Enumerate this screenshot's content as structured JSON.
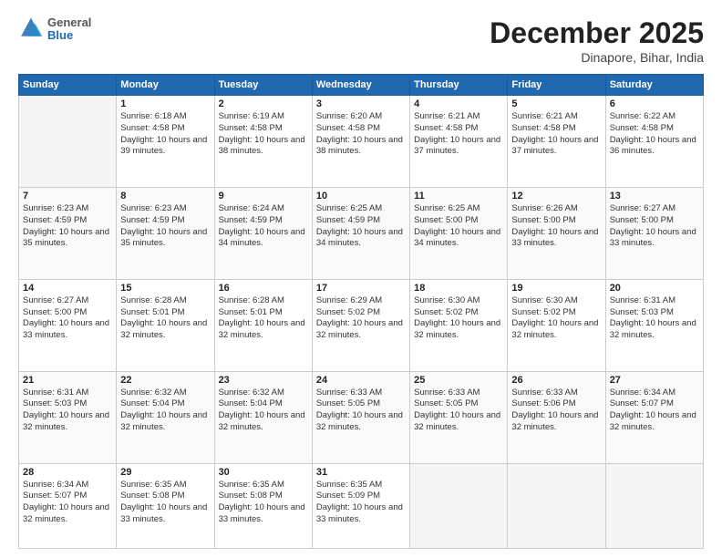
{
  "header": {
    "logo_general": "General",
    "logo_blue": "Blue",
    "month_year": "December 2025",
    "location": "Dinapore, Bihar, India"
  },
  "weekdays": [
    "Sunday",
    "Monday",
    "Tuesday",
    "Wednesday",
    "Thursday",
    "Friday",
    "Saturday"
  ],
  "weeks": [
    [
      {
        "day": "",
        "empty": true
      },
      {
        "day": "1",
        "sunrise": "6:18 AM",
        "sunset": "4:58 PM",
        "daylight": "10 hours and 39 minutes."
      },
      {
        "day": "2",
        "sunrise": "6:19 AM",
        "sunset": "4:58 PM",
        "daylight": "10 hours and 38 minutes."
      },
      {
        "day": "3",
        "sunrise": "6:20 AM",
        "sunset": "4:58 PM",
        "daylight": "10 hours and 38 minutes."
      },
      {
        "day": "4",
        "sunrise": "6:21 AM",
        "sunset": "4:58 PM",
        "daylight": "10 hours and 37 minutes."
      },
      {
        "day": "5",
        "sunrise": "6:21 AM",
        "sunset": "4:58 PM",
        "daylight": "10 hours and 37 minutes."
      },
      {
        "day": "6",
        "sunrise": "6:22 AM",
        "sunset": "4:58 PM",
        "daylight": "10 hours and 36 minutes."
      }
    ],
    [
      {
        "day": "7",
        "sunrise": "6:23 AM",
        "sunset": "4:59 PM",
        "daylight": "10 hours and 35 minutes."
      },
      {
        "day": "8",
        "sunrise": "6:23 AM",
        "sunset": "4:59 PM",
        "daylight": "10 hours and 35 minutes."
      },
      {
        "day": "9",
        "sunrise": "6:24 AM",
        "sunset": "4:59 PM",
        "daylight": "10 hours and 34 minutes."
      },
      {
        "day": "10",
        "sunrise": "6:25 AM",
        "sunset": "4:59 PM",
        "daylight": "10 hours and 34 minutes."
      },
      {
        "day": "11",
        "sunrise": "6:25 AM",
        "sunset": "5:00 PM",
        "daylight": "10 hours and 34 minutes."
      },
      {
        "day": "12",
        "sunrise": "6:26 AM",
        "sunset": "5:00 PM",
        "daylight": "10 hours and 33 minutes."
      },
      {
        "day": "13",
        "sunrise": "6:27 AM",
        "sunset": "5:00 PM",
        "daylight": "10 hours and 33 minutes."
      }
    ],
    [
      {
        "day": "14",
        "sunrise": "6:27 AM",
        "sunset": "5:00 PM",
        "daylight": "10 hours and 33 minutes."
      },
      {
        "day": "15",
        "sunrise": "6:28 AM",
        "sunset": "5:01 PM",
        "daylight": "10 hours and 32 minutes."
      },
      {
        "day": "16",
        "sunrise": "6:28 AM",
        "sunset": "5:01 PM",
        "daylight": "10 hours and 32 minutes."
      },
      {
        "day": "17",
        "sunrise": "6:29 AM",
        "sunset": "5:02 PM",
        "daylight": "10 hours and 32 minutes."
      },
      {
        "day": "18",
        "sunrise": "6:30 AM",
        "sunset": "5:02 PM",
        "daylight": "10 hours and 32 minutes."
      },
      {
        "day": "19",
        "sunrise": "6:30 AM",
        "sunset": "5:02 PM",
        "daylight": "10 hours and 32 minutes."
      },
      {
        "day": "20",
        "sunrise": "6:31 AM",
        "sunset": "5:03 PM",
        "daylight": "10 hours and 32 minutes."
      }
    ],
    [
      {
        "day": "21",
        "sunrise": "6:31 AM",
        "sunset": "5:03 PM",
        "daylight": "10 hours and 32 minutes."
      },
      {
        "day": "22",
        "sunrise": "6:32 AM",
        "sunset": "5:04 PM",
        "daylight": "10 hours and 32 minutes."
      },
      {
        "day": "23",
        "sunrise": "6:32 AM",
        "sunset": "5:04 PM",
        "daylight": "10 hours and 32 minutes."
      },
      {
        "day": "24",
        "sunrise": "6:33 AM",
        "sunset": "5:05 PM",
        "daylight": "10 hours and 32 minutes."
      },
      {
        "day": "25",
        "sunrise": "6:33 AM",
        "sunset": "5:05 PM",
        "daylight": "10 hours and 32 minutes."
      },
      {
        "day": "26",
        "sunrise": "6:33 AM",
        "sunset": "5:06 PM",
        "daylight": "10 hours and 32 minutes."
      },
      {
        "day": "27",
        "sunrise": "6:34 AM",
        "sunset": "5:07 PM",
        "daylight": "10 hours and 32 minutes."
      }
    ],
    [
      {
        "day": "28",
        "sunrise": "6:34 AM",
        "sunset": "5:07 PM",
        "daylight": "10 hours and 32 minutes."
      },
      {
        "day": "29",
        "sunrise": "6:35 AM",
        "sunset": "5:08 PM",
        "daylight": "10 hours and 33 minutes."
      },
      {
        "day": "30",
        "sunrise": "6:35 AM",
        "sunset": "5:08 PM",
        "daylight": "10 hours and 33 minutes."
      },
      {
        "day": "31",
        "sunrise": "6:35 AM",
        "sunset": "5:09 PM",
        "daylight": "10 hours and 33 minutes."
      },
      {
        "day": "",
        "empty": true
      },
      {
        "day": "",
        "empty": true
      },
      {
        "day": "",
        "empty": true
      }
    ]
  ]
}
